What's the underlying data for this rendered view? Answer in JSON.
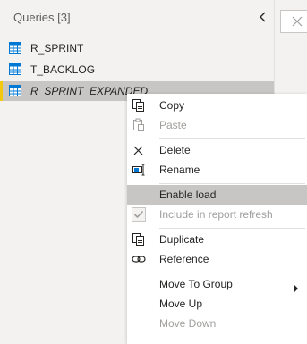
{
  "queries_pane": {
    "title": "Queries [3]",
    "items": [
      {
        "label": "R_SPRINT",
        "icon": "table-icon",
        "selected": false
      },
      {
        "label": "T_BACKLOG",
        "icon": "table-icon",
        "selected": false
      },
      {
        "label": "R_SPRINT_EXPANDED",
        "icon": "table-icon",
        "selected": true
      }
    ]
  },
  "context_menu": {
    "items": [
      {
        "label": "Copy",
        "icon": "copy-icon",
        "enabled": true
      },
      {
        "label": "Paste",
        "icon": "paste-icon",
        "enabled": false
      },
      {
        "label": "Delete",
        "icon": "delete-icon",
        "enabled": true
      },
      {
        "label": "Rename",
        "icon": "rename-icon",
        "enabled": true
      },
      {
        "label": "Enable load",
        "icon": "",
        "enabled": true,
        "highlighted": true
      },
      {
        "label": "Include in report refresh",
        "icon": "checkbox-icon",
        "enabled": false,
        "checked": true
      },
      {
        "label": "Duplicate",
        "icon": "duplicate-icon",
        "enabled": true
      },
      {
        "label": "Reference",
        "icon": "reference-icon",
        "enabled": true
      },
      {
        "label": "Move To Group",
        "icon": "",
        "enabled": true,
        "submenu": true
      },
      {
        "label": "Move Up",
        "icon": "",
        "enabled": true
      },
      {
        "label": "Move Down",
        "icon": "",
        "enabled": false
      }
    ]
  },
  "colors": {
    "selection": "#c8c6c4",
    "accent": "#f2c811",
    "disabled_text": "#a19f9d",
    "table_icon": "#0078d4"
  }
}
